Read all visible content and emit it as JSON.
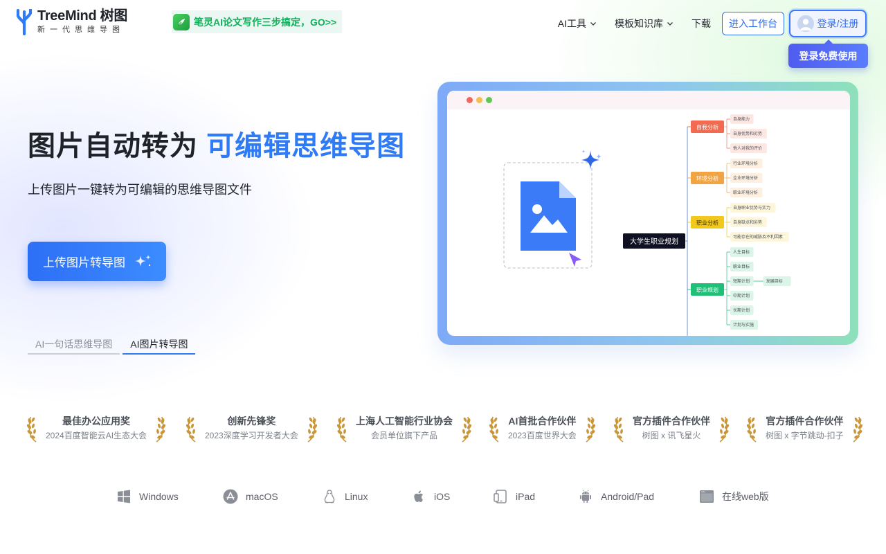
{
  "header": {
    "logo_name": "TreeMind 树图",
    "logo_tagline": "新一代思维导图",
    "promo_text": "笔灵AI论文写作三步搞定，GO>>",
    "nav": [
      {
        "label": "AI工具",
        "dropdown": true
      },
      {
        "label": "模板知识库",
        "dropdown": true
      },
      {
        "label": "下载",
        "dropdown": false
      }
    ],
    "workspace_button": "进入工作台",
    "login_button": "登录/注册",
    "login_tooltip": "登录免费使用"
  },
  "hero": {
    "title_plain": "图片自动转为",
    "title_accent": "可编辑思维导图",
    "subtitle": "上传图片一键转为可编辑的思维导图文件",
    "upload_button": "上传图片转导图",
    "tabs": [
      {
        "label": "AI一句话思维导图",
        "active": false
      },
      {
        "label": "AI图片转导图",
        "active": true
      }
    ]
  },
  "mindmap": {
    "root": "大学生职业规划",
    "branches": [
      {
        "label": "自我分析",
        "color": "#f26a4f",
        "children": [
          "自身能力",
          "自身优势和劣势",
          "他人对我的评价"
        ]
      },
      {
        "label": "环境分析",
        "color": "#f0a444",
        "children": [
          "行业环境分析",
          "企业环境分析",
          "职业环境分析"
        ]
      },
      {
        "label": "职业分析",
        "color": "#f2c81c",
        "children": [
          "自身职业优势与实力",
          "自身缺点和劣势",
          "可能存在的威胁及不利因素"
        ]
      },
      {
        "label": "职业规划",
        "color": "#1fbf78",
        "children": [
          "人生目标",
          "职业目标",
          "短期计划",
          "中期计划",
          "长期计划",
          "计划与实施"
        ],
        "extra": "发展目标"
      }
    ]
  },
  "awards": [
    {
      "title": "最佳办公应用奖",
      "sub": "2024百度智能云AI生态大会"
    },
    {
      "title": "创新先锋奖",
      "sub": "2023深度学习开发者大会"
    },
    {
      "title": "上海人工智能行业协会",
      "sub": "会员单位旗下产品"
    },
    {
      "title": "AI首批合作伙伴",
      "sub": "2023百度世界大会"
    },
    {
      "title": "官方插件合作伙伴",
      "sub": "树图 x 讯飞星火"
    },
    {
      "title": "官方插件合作伙伴",
      "sub": "树图 x 字节跳动-扣子"
    }
  ],
  "platforms": [
    {
      "label": "Windows",
      "icon": "windows-icon"
    },
    {
      "label": "macOS",
      "icon": "appstore-icon"
    },
    {
      "label": "Linux",
      "icon": "linux-icon"
    },
    {
      "label": "iOS",
      "icon": "apple-icon"
    },
    {
      "label": "iPad",
      "icon": "tablet-icon"
    },
    {
      "label": "Android/Pad",
      "icon": "android-icon"
    },
    {
      "label": "在线web版",
      "icon": "browser-icon"
    }
  ],
  "colors": {
    "accent": "#2f7bf6",
    "promo_green": "#12b05a",
    "tooltip": "#5468f2"
  }
}
